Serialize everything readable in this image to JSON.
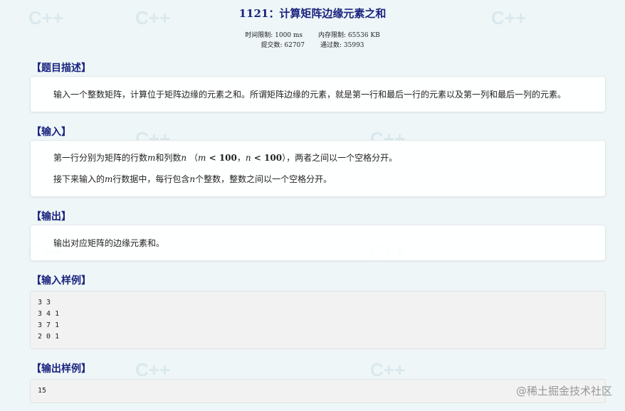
{
  "problem": {
    "title": "1121：计算矩阵边缘元素之和",
    "time_limit": "时间限制: 1000 ms",
    "memory_limit": "内存限制: 65536 KB",
    "submissions": "提交数: 62707",
    "accepted": "通过数: 35993"
  },
  "sections": {
    "description": {
      "heading": "【题目描述】",
      "text": "输入一个整数矩阵，计算位于矩阵边缘的元素之和。所谓矩阵边缘的元素，就是第一行和最后一行的元素以及第一列和最后一列的元素。"
    },
    "input": {
      "heading": "【输入】",
      "line1_a": "第一行分别为矩阵的行数",
      "line1_m": "m",
      "line1_b": "和列数",
      "line1_n": "n",
      "line1_c1": "（",
      "line1_m2": "m",
      "line1_lt1": " < ",
      "line1_v1": "100",
      "line1_comma": "，",
      "line1_n2": "n",
      "line1_lt2": " < ",
      "line1_v2": "100",
      "line1_c2": "），两者之间以一个空格分开。",
      "line2_a": "接下来输入的",
      "line2_m": "m",
      "line2_b": "行数据中，每行包含",
      "line2_n": "n",
      "line2_c": "个整数，整数之间以一个空格分开。"
    },
    "output": {
      "heading": "【输出】",
      "text": "输出对应矩阵的边缘元素和。"
    },
    "sample_input": {
      "heading": "【输入样例】",
      "lines": [
        "3 3",
        "3 4 1",
        "3 7 1",
        "2 0 1"
      ]
    },
    "sample_output": {
      "heading": "【输出样例】",
      "lines": [
        "15"
      ]
    }
  },
  "watermark": {
    "text": "@稀土掘金技术社区",
    "pattern_text": "C++"
  }
}
